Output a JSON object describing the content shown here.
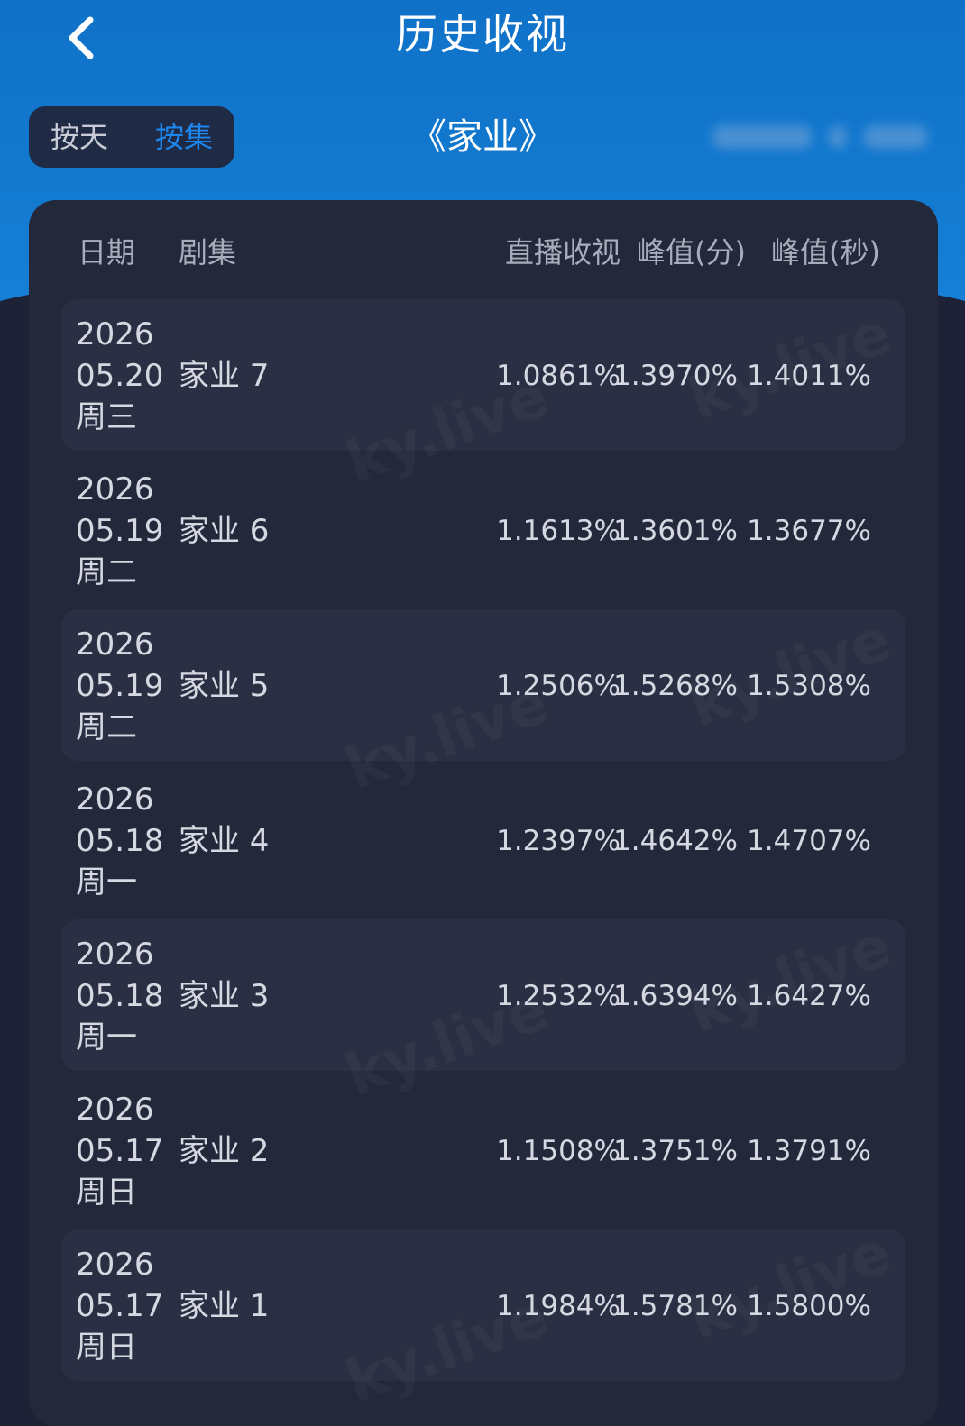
{
  "header": {
    "title": "历史收视",
    "toggle": {
      "by_day": "按天",
      "by_episode": "按集",
      "active": "按集"
    },
    "show_title": "《家业》"
  },
  "table": {
    "columns": {
      "date": "日期",
      "episode": "剧集",
      "live_rating": "直播收视",
      "peak_min": "峰值(分)",
      "peak_sec": "峰值(秒)"
    },
    "rows": [
      {
        "year": "2026",
        "date": "05.20",
        "weekday": "周三",
        "episode": "家业 7",
        "live_rating": "1.0861%",
        "peak_min": "1.3970%",
        "peak_sec": "1.4011%"
      },
      {
        "year": "2026",
        "date": "05.19",
        "weekday": "周二",
        "episode": "家业 6",
        "live_rating": "1.1613%",
        "peak_min": "1.3601%",
        "peak_sec": "1.3677%"
      },
      {
        "year": "2026",
        "date": "05.19",
        "weekday": "周二",
        "episode": "家业 5",
        "live_rating": "1.2506%",
        "peak_min": "1.5268%",
        "peak_sec": "1.5308%"
      },
      {
        "year": "2026",
        "date": "05.18",
        "weekday": "周一",
        "episode": "家业 4",
        "live_rating": "1.2397%",
        "peak_min": "1.4642%",
        "peak_sec": "1.4707%"
      },
      {
        "year": "2026",
        "date": "05.18",
        "weekday": "周一",
        "episode": "家业 3",
        "live_rating": "1.2532%",
        "peak_min": "1.6394%",
        "peak_sec": "1.6427%"
      },
      {
        "year": "2026",
        "date": "05.17",
        "weekday": "周日",
        "episode": "家业 2",
        "live_rating": "1.1508%",
        "peak_min": "1.3751%",
        "peak_sec": "1.3791%"
      },
      {
        "year": "2026",
        "date": "05.17",
        "weekday": "周日",
        "episode": "家业 1",
        "live_rating": "1.1984%",
        "peak_min": "1.5781%",
        "peak_sec": "1.5800%"
      }
    ]
  },
  "watermark": "ky.live",
  "icons": {
    "back": "chevron-left-icon"
  },
  "colors": {
    "header_blue": "#1279cf",
    "active_toggle": "#1d87f0",
    "background": "#1e2236"
  }
}
